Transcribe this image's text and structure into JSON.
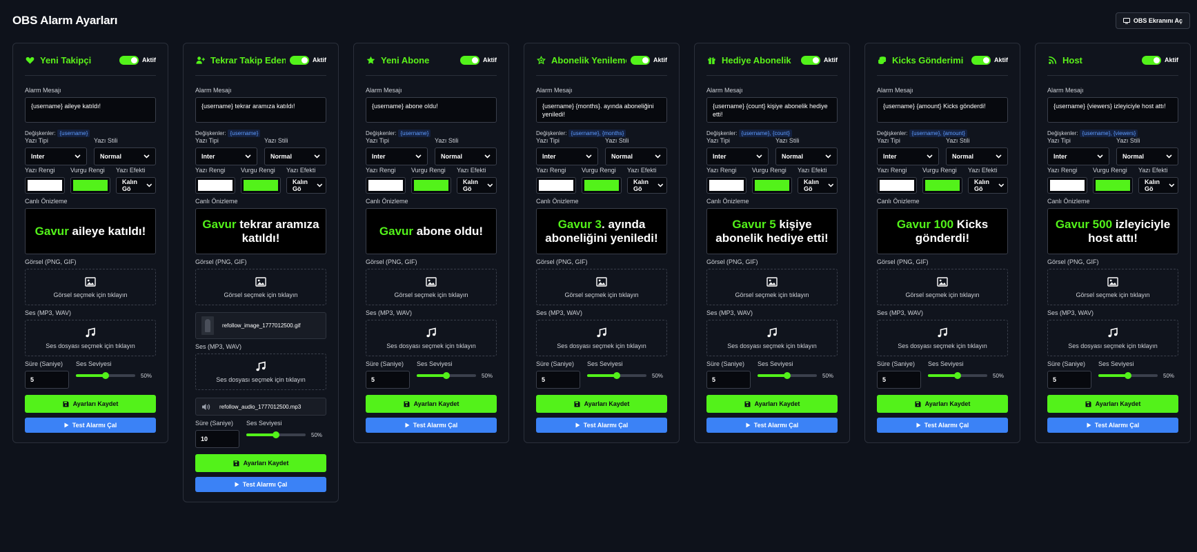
{
  "header": {
    "title": "OBS Alarm Ayarları",
    "obs_button_label": "OBS Ekranını Aç",
    "obs_button_icon": "monitor-icon"
  },
  "colors": {
    "accent_green": "#53f21a",
    "button_blue": "#3b82f6",
    "text_color_value": "#ffffff",
    "highlight_color_value": "#53f21a"
  },
  "labels": {
    "active": "Aktif",
    "alarm_message": "Alarm Mesajı",
    "variables": "Değişkenler:",
    "font_type": "Yazı Tipi",
    "font_style": "Yazı Stili",
    "text_color": "Yazı Rengi",
    "highlight_color": "Vurgu Rengi",
    "text_effect": "Yazı Efekti",
    "live_preview": "Canlı Önizleme",
    "image_label": "Görsel (PNG, GIF)",
    "image_prompt": "Görsel seçmek için tıklayın",
    "sound_label": "Ses (MP3, WAV)",
    "sound_prompt": "Ses dosyası seçmek için tıklayın",
    "duration": "Süre (Saniye)",
    "volume": "Ses Seviyesi",
    "save": "Ayarları Kaydet",
    "test": "Test Alarmı Çal"
  },
  "cards": [
    {
      "title": "Yeni Takipçi",
      "icon": "heart-icon",
      "enabled": true,
      "message": "{username} aileye katıldı!",
      "variables": "{username}",
      "font": "Inter",
      "style": "Normal",
      "effect": "Kalın Gö",
      "preview_highlight": "Gavur",
      "preview_rest": " aileye katıldı!",
      "image_file": "",
      "audio_file": "",
      "duration": "5",
      "volume": 0.5,
      "volume_label": "50%"
    },
    {
      "title": "Tekrar Takip Edenler",
      "icon": "user-plus-icon",
      "enabled": true,
      "message": "{username} tekrar aramıza katıldı!",
      "variables": "{username}",
      "font": "Inter",
      "style": "Normal",
      "effect": "Kalın Gö",
      "preview_highlight": "Gavur",
      "preview_rest": " tekrar aramıza katıldı!",
      "image_file": "refollow_image_1777012500.gif",
      "audio_file": "refollow_audio_1777012500.mp3",
      "duration": "10",
      "volume": 0.5,
      "volume_label": "50%"
    },
    {
      "title": "Yeni Abone",
      "icon": "star-icon",
      "enabled": true,
      "message": "{username} abone oldu!",
      "variables": "{username}",
      "font": "Inter",
      "style": "Normal",
      "effect": "Kalın Gö",
      "preview_highlight": "Gavur",
      "preview_rest": " abone oldu!",
      "image_file": "",
      "audio_file": "",
      "duration": "5",
      "volume": 0.5,
      "volume_label": "50%"
    },
    {
      "title": "Abonelik Yenileme",
      "icon": "star-outline-icon",
      "enabled": true,
      "message": "{username} {months}. ayında aboneliğini yeniledi!",
      "variables": "{username}, {months}",
      "font": "Inter",
      "style": "Normal",
      "effect": "Kalın Gö",
      "preview_highlight": "Gavur 3",
      "preview_rest": ". ayında aboneliğini yeniledi!",
      "image_file": "",
      "audio_file": "",
      "duration": "5",
      "volume": 0.5,
      "volume_label": "50%"
    },
    {
      "title": "Hediye Abonelik",
      "icon": "gift-icon",
      "enabled": true,
      "message": "{username} {count} kişiye abonelik hediye etti!",
      "variables": "{username}, {count}",
      "font": "Inter",
      "style": "Normal",
      "effect": "Kalın Gö",
      "preview_highlight": "Gavur 5",
      "preview_rest": " kişiye abonelik hediye etti!",
      "image_file": "",
      "audio_file": "",
      "duration": "5",
      "volume": 0.5,
      "volume_label": "50%"
    },
    {
      "title": "Kicks Gönderimi",
      "icon": "coins-icon",
      "enabled": true,
      "message": "{username} {amount} Kicks gönderdi!",
      "variables": "{username}, {amount}",
      "font": "Inter",
      "style": "Normal",
      "effect": "Kalın Gö",
      "preview_highlight": "Gavur 100",
      "preview_rest": " Kicks gönderdi!",
      "image_file": "",
      "audio_file": "",
      "duration": "5",
      "volume": 0.5,
      "volume_label": "50%"
    },
    {
      "title": "Host",
      "icon": "broadcast-icon",
      "enabled": true,
      "message": "{username} {viewers} izleyiciyle host attı!",
      "variables": "{username}, {viewers}",
      "font": "Inter",
      "style": "Normal",
      "effect": "Kalın Gö",
      "preview_highlight": "Gavur 500",
      "preview_rest": " izleyiciyle host attı!",
      "image_file": "",
      "audio_file": "",
      "duration": "5",
      "volume": 0.5,
      "volume_label": "50%"
    }
  ]
}
